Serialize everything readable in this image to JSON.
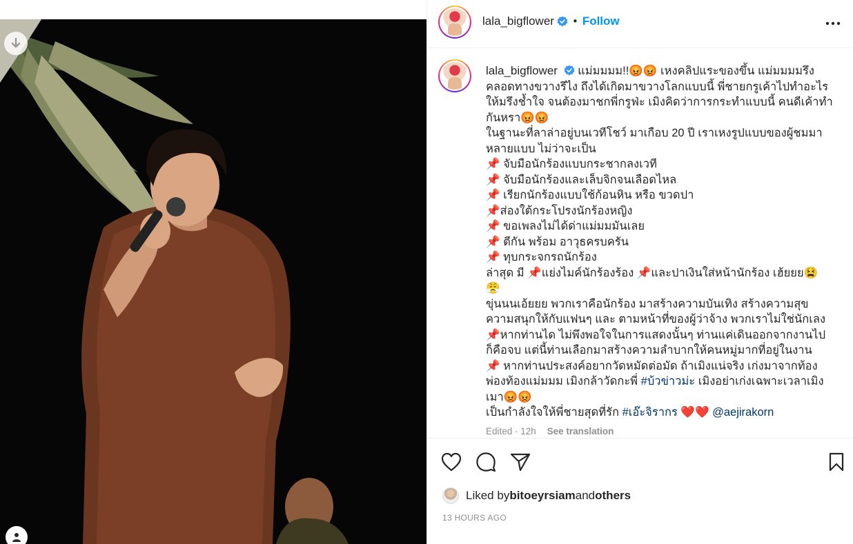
{
  "post": {
    "username": "lala_bigflower",
    "follow_label": "Follow",
    "separator": "•",
    "caption_lines": [
      "แม่มมมม!!😡😡 เหงคลิปแระของขึ้น แม่มมมมรึง",
      "คลอดทางขวางรึไง ถึงได้เกิดมาขวางโลกแบบนี้ พี่ชายกรูเค้าไปทำอะไร",
      "ให้มรึงช้ำใจ จนต้องมาชกพี่กรูฟ่ะ เมิงคิดว่าการกระทำแบบนี้ คนดีเค้าทำ",
      "กันหรา😡😡",
      "ในฐานะที่ลาล่าอยู่บนเวทีโชว์ มาเกือบ 20 ปี เราเหงรูปแบบของผู้ชมมา",
      "หลายแบบ ไม่ว่าจะเป็น",
      "📌 จับมือนักร้องแบบกระชากลงเวที",
      "📌 จับมือนักร้องและเล็บจิกจนเลือดไหล",
      "📌 เรียกนักร้องแบบใช้ก้อนหิน หรือ ขวดปา",
      "📌ส่องใต้กระโปรงนักร้องหญิง",
      "📌 ขอเพลงไม่ได้ด่าแม่มมมันเลย",
      "📌 ตีกัน พร้อม อาวุธครบครัน",
      "📌 ทุบกระจกรถนักร้อง",
      "ล่าสุด มี 📌แย่งไมค์นักร้องร้อง 📌และปาเงินใส่หน้านักร้อง เฮ้ยยย😫",
      "😤",
      "ขุ่นนนเอ้ยยย พวกเราคือนักร้อง มาสร้างความบันเทิง สร้างความสุข",
      "ความสนุกให้กับแฟนๆ และ ตามหน้าที่ของผู้ว่าจ้าง พวกเราไม่ใช่นักเลง",
      "📌หากท่านได ไม่พึงพอใจในการแสดงนั้นๆ ท่านแค่เดินออกจากงานไป",
      "ก็คือจบ แต่นี้ท่านเลือกมาสร้างความลำบากให้คนหมู่มากที่อยู่ในงาน",
      "📌 หากท่านประสงค์อยากวัดหมัดต่อมัด ถ้าเมิงแน่จริง เก่งมาจากท้อง",
      "พ่องท้องแม่มมม เมิงกล้าวัดกะพี่ ",
      "เมา😡😡",
      "เป็นกำลังใจให้พี่ชายสุดที่รัก "
    ],
    "hashtag_1": "#บ้วข่าวม่ะ",
    "after_hashtag_1": " เมิงอย่าเก่งเฉพาะเวลาเมิง",
    "hashtag_2": "#เอ๊ะจิรากร",
    "hearts": " ❤️❤️ ",
    "mention": "@aejirakorn",
    "edited_label": "Edited · 12h",
    "see_translation": "See translation",
    "liked_by_prefix": "Liked by ",
    "liked_by_user": "bitoeyrsiam",
    "liked_by_and": " and ",
    "liked_by_others": "others",
    "time_ago": "13 HOURS AGO"
  },
  "icons": [
    "download-icon",
    "user-tag-icon",
    "verified-badge-icon",
    "more-options-icon",
    "heart-icon",
    "comment-icon",
    "share-icon",
    "bookmark-icon"
  ],
  "colors": {
    "accent": "#0095f6",
    "text": "#262626",
    "muted": "#8e8e8e",
    "hashtag": "#00376b"
  }
}
